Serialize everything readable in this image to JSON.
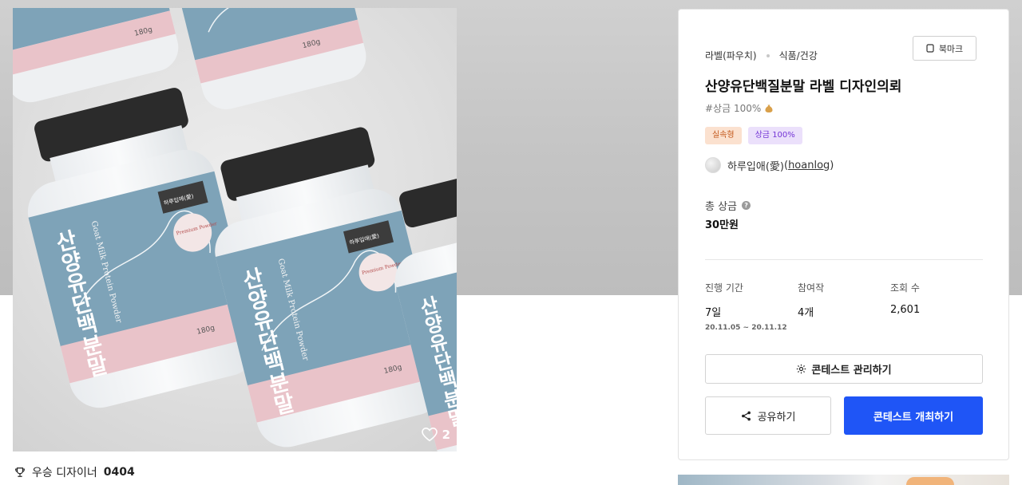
{
  "hero": {
    "image_text": {
      "product_name_ko": "산양유단백분말",
      "product_name_en": "Goat Milk Protein Powder",
      "brand": "하루입애(愛)",
      "seal": "Premium Powder",
      "weight": "180g"
    },
    "likes_count": "2"
  },
  "winner": {
    "label": "우승 디자이너",
    "number": "0404"
  },
  "panel": {
    "category_primary": "라벨(파우치)",
    "category_secondary": "식품/건강",
    "bookmark_label": "북마크",
    "title": "산양유단백질분말 라벨 디자인의뢰",
    "tagline": "#상금 100%",
    "badges": [
      "실속형",
      "상금 100%"
    ],
    "designer_name": "하루입애(愛)",
    "designer_handle": "hoanlog",
    "prize_label": "총 상금",
    "prize_value": "30만원",
    "stats": {
      "period_label": "진행 기간",
      "period_value": "7일",
      "period_range": "20.11.05 ~ 20.11.12",
      "entries_label": "참여작",
      "entries_value": "4개",
      "views_label": "조회 수",
      "views_value": "2,601"
    },
    "manage_button": "콘테스트 관리하기",
    "share_button": "공유하기",
    "open_button": "콘테스트 개최하기"
  },
  "colors": {
    "primary": "#1f55f6",
    "badge_orange_bg": "#fbe1cf",
    "badge_purple_bg": "#ebe0fb",
    "label_blue": "#7ea3b8",
    "label_pink": "#e9c3c9"
  },
  "icons": [
    "heart-icon",
    "trophy-icon",
    "bookmark-icon",
    "question-icon",
    "gear-icon",
    "share-icon"
  ]
}
